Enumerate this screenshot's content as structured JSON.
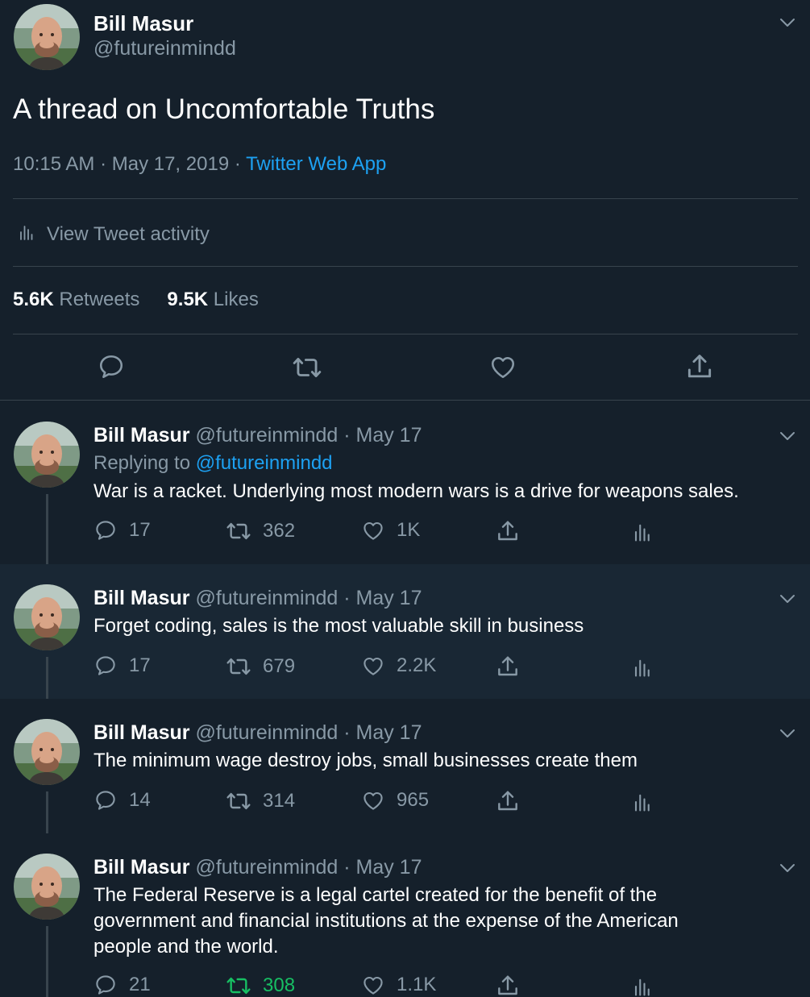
{
  "main_tweet": {
    "author_name": "Bill Masur",
    "handle": "@futureinmindd",
    "text": "A thread on Uncomfortable Truths",
    "timestamp": "10:15 AM · May 17, 2019 · ",
    "source": "Twitter Web App",
    "activity_label": "View Tweet activity",
    "retweets_count": "5.6K",
    "retweets_label": "Retweets",
    "likes_count": "9.5K",
    "likes_label": "Likes"
  },
  "replies": [
    {
      "author_name": "Bill Masur",
      "meta": "@futureinmindd · May 17",
      "replying_prefix": "Replying to ",
      "replying_to": "@futureinmindd",
      "text": "War is a racket.  Underlying most modern wars is a drive for weapons sales.",
      "replies": "17",
      "retweets": "362",
      "likes": "1K"
    },
    {
      "author_name": "Bill Masur",
      "meta": "@futureinmindd · May 17",
      "text": "Forget coding, sales is the most valuable skill in business",
      "replies": "17",
      "retweets": "679",
      "likes": "2.2K"
    },
    {
      "author_name": "Bill Masur",
      "meta": "@futureinmindd · May 17",
      "text": "The minimum wage destroy jobs, small businesses create them",
      "replies": "14",
      "retweets": "314",
      "likes": "965"
    },
    {
      "author_name": "Bill Masur",
      "meta": "@futureinmindd · May 17",
      "text": "The Federal Reserve is a legal cartel created for the benefit of the government and financial institutions at the expense of the American people and the world.",
      "replies": "21",
      "retweets": "308",
      "likes": "1.1K",
      "retweeted": true
    }
  ],
  "colors": {
    "background": "#15202b",
    "highlight_row": "#192734",
    "accent_blue": "#1da1f2",
    "muted": "#8899a6",
    "retweeted_green": "#17bf63",
    "border": "#38444d"
  },
  "icons": [
    "chevron-down-icon",
    "bar-chart-icon",
    "reply-icon",
    "retweet-icon",
    "like-icon",
    "share-icon",
    "analytics-icon"
  ]
}
